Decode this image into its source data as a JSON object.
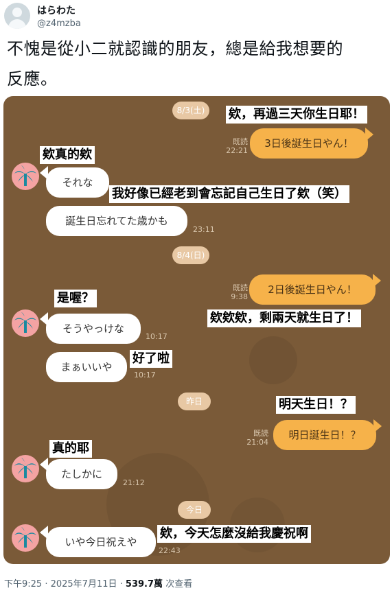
{
  "user": {
    "display_name": "はらわた",
    "handle": "@z4mzba"
  },
  "tweet": {
    "line1": "不愧是從小二就認識的朋友，總是給我想要的",
    "line2": "反應。"
  },
  "chat": {
    "dates": [
      "8/3(土)",
      "8/4(日)",
      "昨日",
      "今日"
    ],
    "read_label": "既読",
    "messages": [
      {
        "text": "3日後誕生日やん！",
        "time": "22:21"
      },
      {
        "text": "それな"
      },
      {
        "text": "誕生日忘れてた歳かも",
        "time": "23:11"
      },
      {
        "text": "2日後誕生日やん！",
        "time": "9:38"
      },
      {
        "text": "そうやっけな",
        "time": "10:17"
      },
      {
        "text": "まぁいいや",
        "time": "10:17"
      },
      {
        "text": "明日誕生日！？",
        "time": "21:04"
      },
      {
        "text": "たしかに",
        "time": "21:12"
      },
      {
        "text": "いや今日祝えや",
        "time": "22:43"
      }
    ],
    "captions": [
      "欸，再過三天你生日耶！",
      "欸真的欸",
      "我好像已經老到會忘記自己生日了欸（笑）",
      "是喔？",
      "欸欸欸，剩兩天就生日了！",
      "好了啦",
      "明天生日！？",
      "真的耶",
      "欸，今天怎麼沒給我慶祝啊"
    ]
  },
  "footer": {
    "timestamp": "下午9:25 · 2025年7月11日",
    "separator": "·",
    "views_count": "539.7萬",
    "views_label": "次查看"
  },
  "colors": {
    "chat_background": "#7a5a38",
    "outgoing_bubble": "#f6b24a",
    "incoming_bubble": "#ffffff",
    "date_pill": "#e8c8a4",
    "friend_avatar": "#f4a3a3",
    "palm_icon": "#1a8aa0"
  },
  "icons": {
    "friend_avatar": "palm-tree-icon",
    "user_avatar": "default-avatar-icon"
  }
}
